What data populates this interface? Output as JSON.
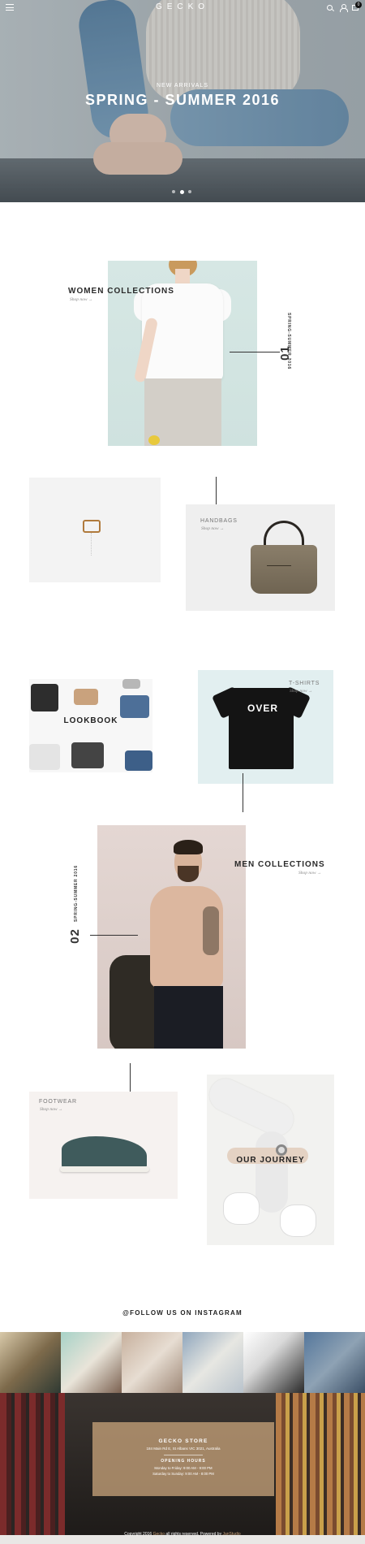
{
  "header": {
    "logo": "GECKO",
    "cart_count": "0"
  },
  "hero": {
    "subtitle": "NEW ARRIVALS",
    "title": "SPRING - SUMMER 2016",
    "slides": 3,
    "active_slide": 2
  },
  "women": {
    "title": "WOMEN COLLECTIONS",
    "shop": "Shop now  →",
    "side_label": "SPRING-SUMMER 2016",
    "number": "01"
  },
  "handbags": {
    "title": "HANDBAGS",
    "shop": "Shop now  →"
  },
  "lookbook": {
    "title": "LOOKBOOK"
  },
  "tshirts": {
    "title": "T-SHIRTS",
    "shop": "Shop now  →",
    "print": "OVER"
  },
  "men": {
    "title": "MEN COLLECTIONS",
    "shop": "Shop now  →",
    "side_label": "SPRING-SUMMER 2016",
    "number": "02"
  },
  "footwear": {
    "title": "FOOTWEAR",
    "shop": "Shop now  →"
  },
  "journey": {
    "title": "OUR JOURNEY"
  },
  "instagram": {
    "title": "@FOLLOW US ON INSTAGRAM"
  },
  "footer": {
    "store_name": "GECKO STORE",
    "address": "184 Main Rd E, St Albans VIC 3021, Australia",
    "hours_title": "OPENING HOURS",
    "hours_weekday": "Monday to Friday: 9:00 AM - 9:00 PM",
    "hours_weekend": "Saturday to Sunday: 9:00 AM - 8:00 PM",
    "copyright_prefix": "Copyright 2016",
    "copyright_brand": "Gecko",
    "copyright_mid": "all rights reserved. Powered by",
    "copyright_powered": "JanStudio"
  },
  "colors": {
    "accent": "#c9a27b",
    "dark": "#222222",
    "store_box": "#c4a079"
  }
}
